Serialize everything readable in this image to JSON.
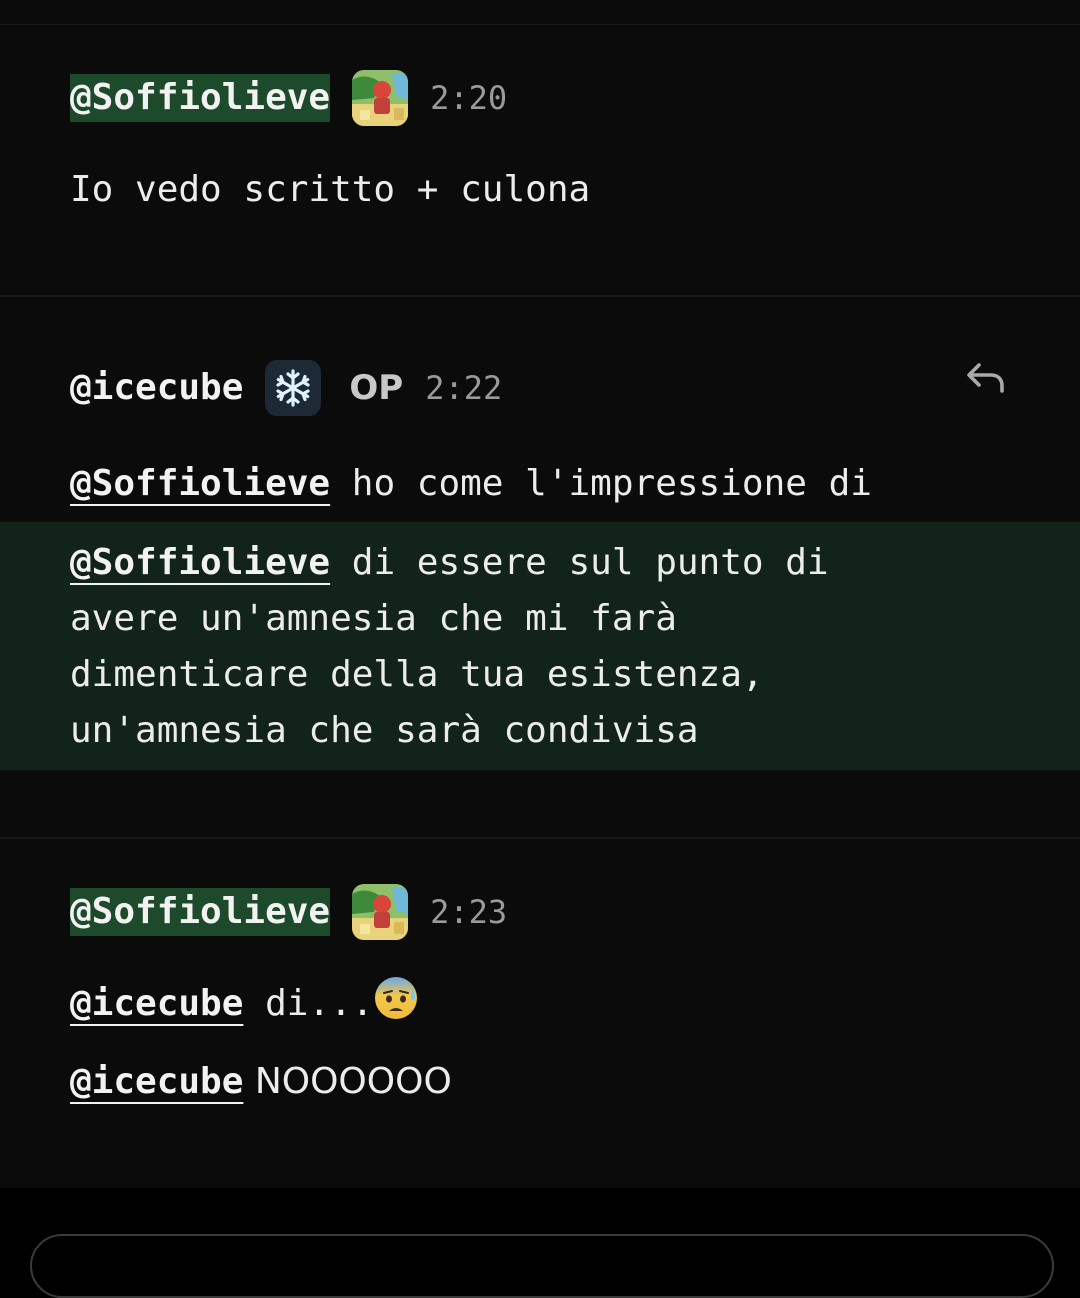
{
  "messages": [
    {
      "username": "@Soffiolieve",
      "time": "2:20",
      "lines": [
        "Io vedo scritto + culona"
      ]
    },
    {
      "username": "@icecube",
      "badge": "OP",
      "time": "2:22",
      "quoted_mention": "@Soffiolieve",
      "quoted_text": " ho come l'impressione di",
      "highlight_mention": "@Soffiolieve",
      "highlight_line1": " di essere sul punto di",
      "highlight_line2": "avere un'amnesia che mi farà",
      "highlight_line3": "dimenticare della tua esistenza,",
      "highlight_line4": "un'amnesia che sarà condivisa"
    },
    {
      "username": "@Soffiolieve",
      "time": "2:23",
      "line1_mention": "@icecube",
      "line1_text": " di...",
      "line1_emoji": "anxious-face-with-sweat",
      "line2_mention": "@icecube",
      "line2_text": " NOOOOOO"
    }
  ],
  "colors": {
    "background": "#0b0b0b",
    "username_highlight": "#1d4a2a",
    "highlight_band": "#12231a"
  },
  "icons": [
    "avatar-soffiolieve",
    "snowflake-icon",
    "reply-icon",
    "anxious-face-icon"
  ]
}
